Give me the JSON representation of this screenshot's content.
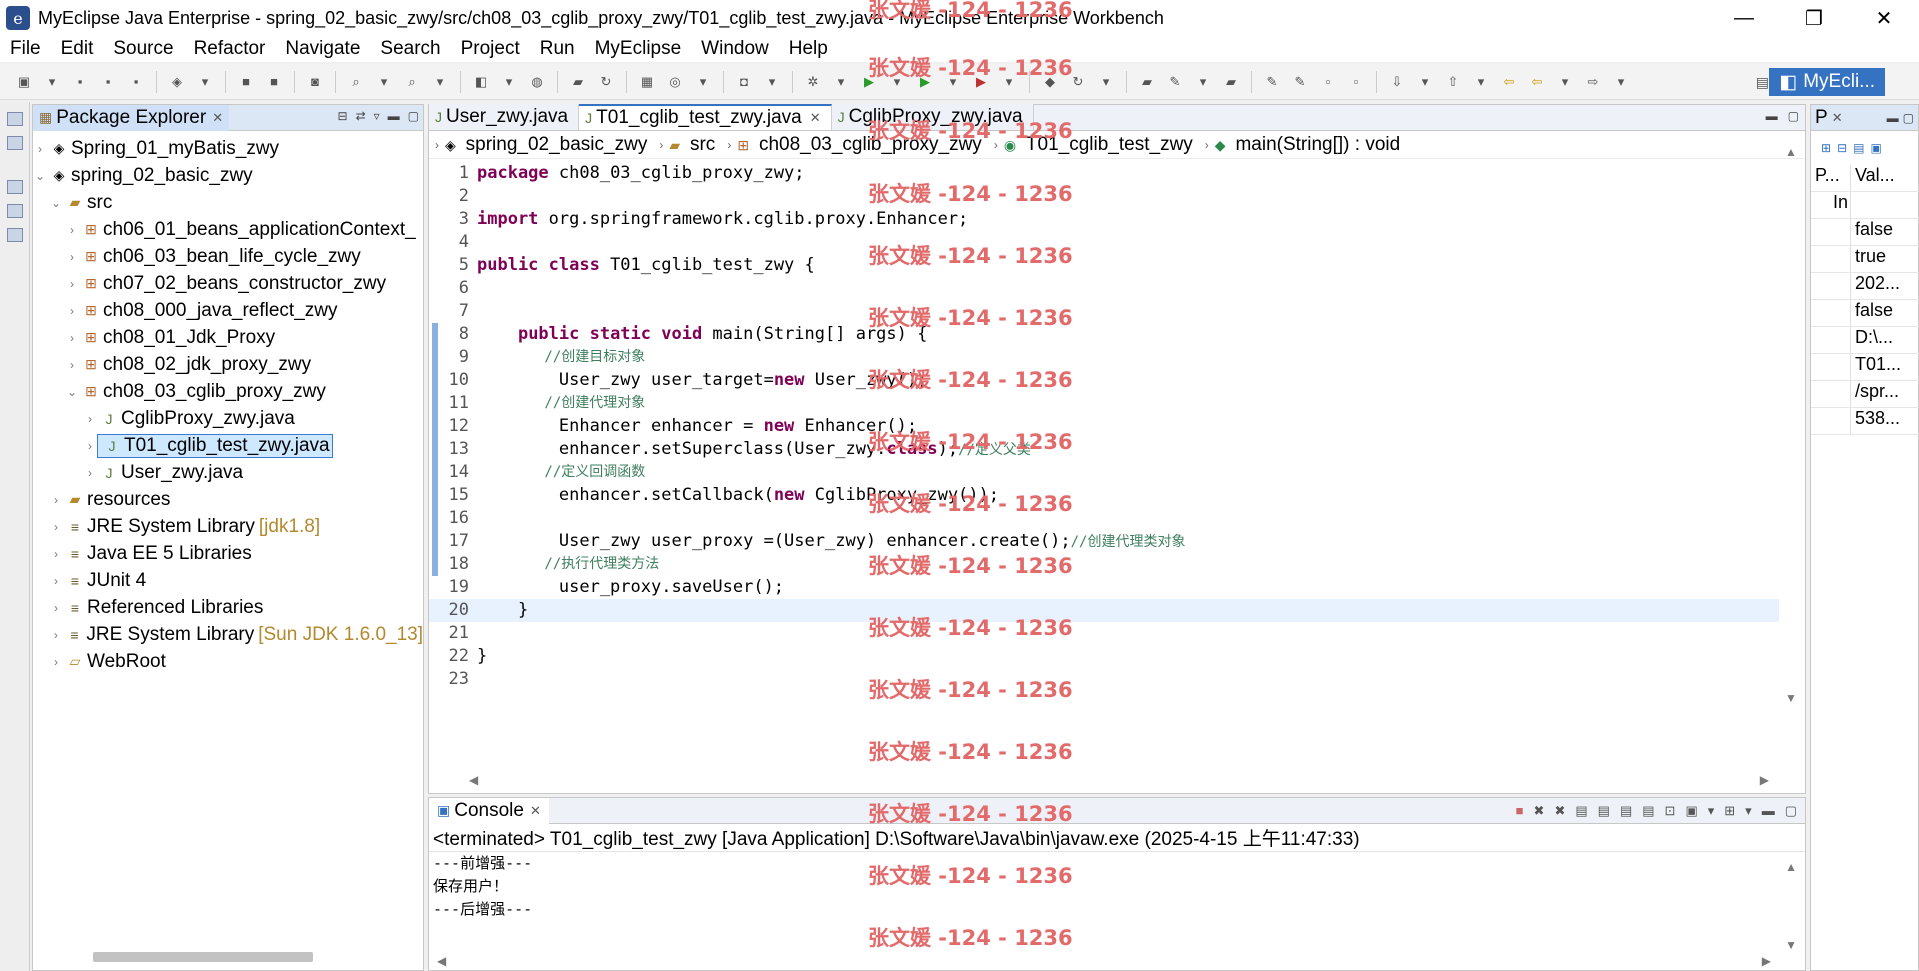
{
  "window": {
    "title": "MyEclipse Java Enterprise - spring_02_basic_zwy/src/ch08_03_cglib_proxy_zwy/T01_cglib_test_zwy.java - MyEclipse Enterprise Workbench",
    "minimize": "—",
    "maximize": "❐",
    "close": "✕"
  },
  "menu": [
    "File",
    "Edit",
    "Source",
    "Refactor",
    "Navigate",
    "Search",
    "Project",
    "Run",
    "MyEclipse",
    "Window",
    "Help"
  ],
  "perspective": "MyEcli...",
  "package_explorer": {
    "title": "Package Explorer",
    "items": [
      {
        "label": "Spring_01_myBatis_zwy",
        "deco": ""
      },
      {
        "label": "spring_02_basic_zwy",
        "deco": ""
      },
      {
        "label": "src",
        "deco": ""
      },
      {
        "label": "ch06_01_beans_applicationContext_",
        "deco": ""
      },
      {
        "label": "ch06_03_bean_life_cycle_zwy",
        "deco": ""
      },
      {
        "label": "ch07_02_beans_constructor_zwy",
        "deco": ""
      },
      {
        "label": "ch08_000_java_reflect_zwy",
        "deco": ""
      },
      {
        "label": "ch08_01_Jdk_Proxy",
        "deco": ""
      },
      {
        "label": "ch08_02_jdk_proxy_zwy",
        "deco": ""
      },
      {
        "label": "ch08_03_cglib_proxy_zwy",
        "deco": ""
      },
      {
        "label": "CglibProxy_zwy.java",
        "deco": ""
      },
      {
        "label": "T01_cglib_test_zwy.java",
        "deco": ""
      },
      {
        "label": "User_zwy.java",
        "deco": ""
      },
      {
        "label": "resources",
        "deco": ""
      },
      {
        "label": "JRE System Library",
        "deco": "[jdk1.8]"
      },
      {
        "label": "Java EE 5 Libraries",
        "deco": ""
      },
      {
        "label": "JUnit 4",
        "deco": ""
      },
      {
        "label": "Referenced Libraries",
        "deco": ""
      },
      {
        "label": "JRE System Library",
        "deco": "[Sun JDK 1.6.0_13]"
      },
      {
        "label": "WebRoot",
        "deco": ""
      }
    ]
  },
  "editor": {
    "tabs": [
      "User_zwy.java",
      "T01_cglib_test_zwy.java",
      "CglibProxy_zwy.java"
    ],
    "breadcrumb": [
      "spring_02_basic_zwy",
      "src",
      "ch08_03_cglib_proxy_zwy",
      "T01_cglib_test_zwy",
      "main(String[]) : void"
    ],
    "line_numbers": [
      "1",
      "2",
      "3",
      "4",
      "5",
      "6",
      "7",
      "8",
      "9",
      "10",
      "11",
      "12",
      "13",
      "14",
      "15",
      "16",
      "17",
      "18",
      "19",
      "20",
      "21",
      "22",
      "23"
    ],
    "code": {
      "l1_kw": "package",
      "l1_rest": " ch08_03_cglib_proxy_zwy;",
      "l3_kw": "import",
      "l3_rest": " org.springframework.cglib.proxy.Enhancer;",
      "l5_kw": "public class",
      "l5_rest": " T01_cglib_test_zwy {",
      "l8_indent": "    ",
      "l8_kw": "public static void",
      "l8_rest": " main(String[] args) {",
      "l9": "        //创建目标对象",
      "l10_a": "        User_zwy user_target=",
      "l10_kw": "new",
      "l10_b": " User_zwy();",
      "l11": "        //创建代理对象",
      "l12_a": "        Enhancer enhancer = ",
      "l12_kw": "new",
      "l12_b": " Enhancer();",
      "l13_a": "        enhancer.setSuperclass(User_zwy.",
      "l13_kw": "class",
      "l13_b": ");",
      "l13_cm": "//定义父类",
      "l14": "        //定义回调函数",
      "l15_a": "        enhancer.setCallback(",
      "l15_kw": "new",
      "l15_b": " CglibProxy_zwy());",
      "l17_a": "        User_zwy user_proxy =(User_zwy) enhancer.create();",
      "l17_cm": "//创建代理类对象",
      "l18": "        //执行代理类方法",
      "l19": "        user_proxy.saveUser();",
      "l20": "    }",
      "l22": "}"
    }
  },
  "console": {
    "title": "Console",
    "status": "<terminated> T01_cglib_test_zwy [Java Application] D:\\Software\\Java\\bin\\javaw.exe (2025-4-15 上午11:47:33)",
    "output": [
      "---前增强---",
      "保存用户！",
      "---后增强---"
    ]
  },
  "properties": {
    "title": "P",
    "header": [
      "P...",
      "Val..."
    ],
    "subheader": "In",
    "values": [
      "false",
      "true",
      "202...",
      "false",
      "D:\\...",
      "T01...",
      "/spr...",
      "538..."
    ]
  },
  "watermark": "张文媛 -124 - 1236",
  "colors": {
    "accent": "#3572c1",
    "keyword": "#7f0055",
    "comment": "#3f7f5f",
    "watermark": "#e36a6a"
  }
}
